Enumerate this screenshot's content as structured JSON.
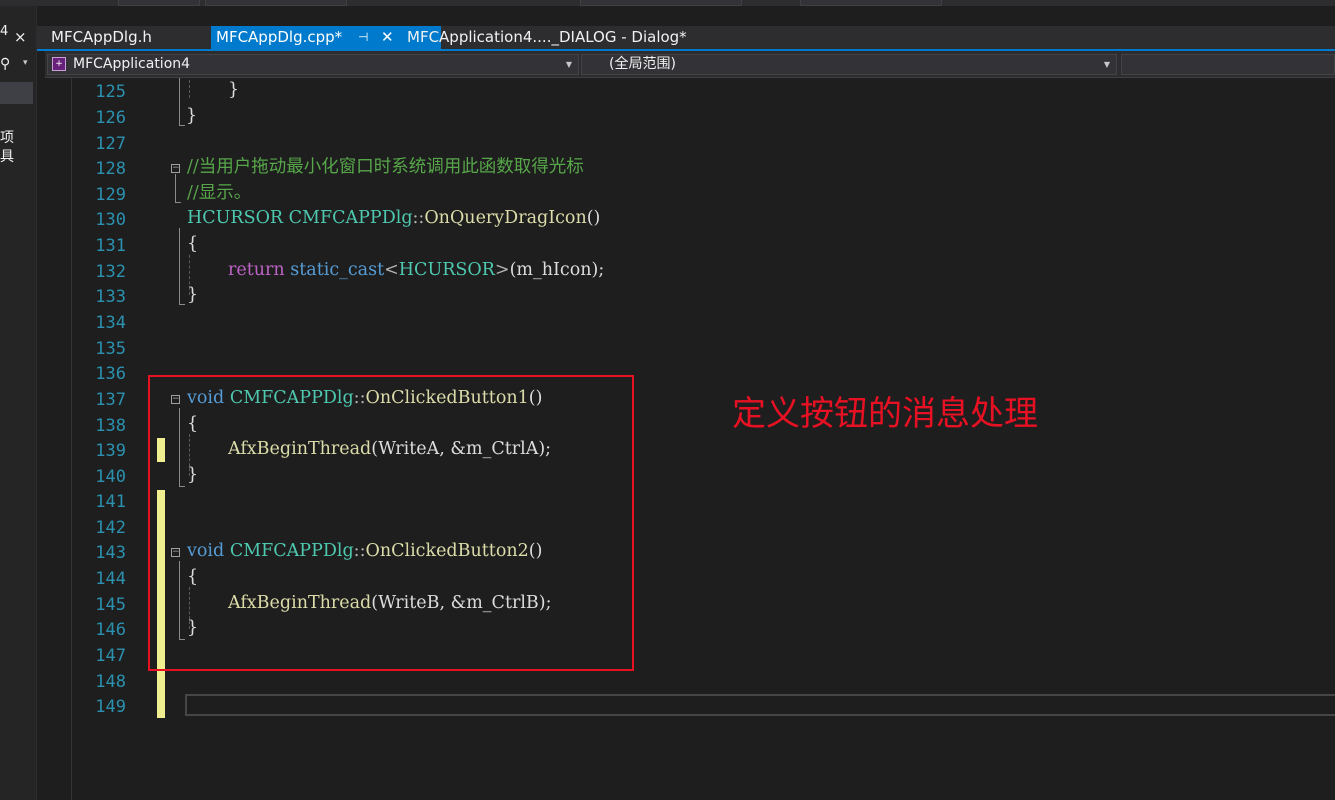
{
  "sidebar": {
    "title_glyph": "4",
    "close_icon": "×",
    "search_icon": "⚲",
    "dropdown_icon": "▾",
    "text1": "项",
    "text2": "具"
  },
  "tabs": [
    {
      "label": "MFCAppDlg.h"
    },
    {
      "label": "MFCAppDlg.cpp*",
      "active": true,
      "pin": "⊣",
      "close": "✕"
    },
    {
      "label": "MFCApplication4...._DIALOG - Dialog*"
    }
  ],
  "navbar": {
    "project": "MFCApplication4",
    "scope": "(全局范围)",
    "member": ""
  },
  "editor": {
    "line_numbers": [
      "125",
      "126",
      "127",
      "128",
      "129",
      "130",
      "131",
      "132",
      "133",
      "134",
      "135",
      "136",
      "137",
      "138",
      "139",
      "140",
      "141",
      "142",
      "143",
      "144",
      "145",
      "146",
      "147",
      "148",
      "149"
    ],
    "code": {
      "l125": "}",
      "l126": "}",
      "l128": "//当用户拖动最小化窗口时系统调用此函数取得光标",
      "l129": "//显示。",
      "l130_type": "HCURSOR",
      "l130_class": "CMFCAPPDlg",
      "l130_sep": "::",
      "l130_fn": "OnQueryDragIcon",
      "l130_paren": "()",
      "l131": "{",
      "l132_kw": "return",
      "l132_cast": "static_cast",
      "l132_lt": "<",
      "l132_type": "HCURSOR",
      "l132_gt": ">",
      "l132_rest": "(m_hIcon);",
      "l133": "}",
      "l137_kw": "void",
      "l137_class": "CMFCAPPDlg",
      "l137_sep": "::",
      "l137_fn": "OnClickedButton1",
      "l137_paren": "()",
      "l138": "{",
      "l139_fn": "AfxBeginThread",
      "l139_rest": "(WriteA, &m_CtrlA);",
      "l140": "}",
      "l143_kw": "void",
      "l143_class": "CMFCAPPDlg",
      "l143_sep": "::",
      "l143_fn": "OnClickedButton2",
      "l143_paren": "()",
      "l144": "{",
      "l145_fn": "AfxBeginThread",
      "l145_rest": "(WriteB, &m_CtrlB);",
      "l146": "}"
    }
  },
  "annotation": "定义按钮的消息处理",
  "colors": {
    "accent": "#007acc",
    "annotation": "#e81123",
    "keyword": "#569cd6",
    "class": "#4ec9b0",
    "function": "#dcdcaa",
    "comment": "#57a64a",
    "line_number": "#2b91af",
    "change_marker": "#efef91"
  }
}
